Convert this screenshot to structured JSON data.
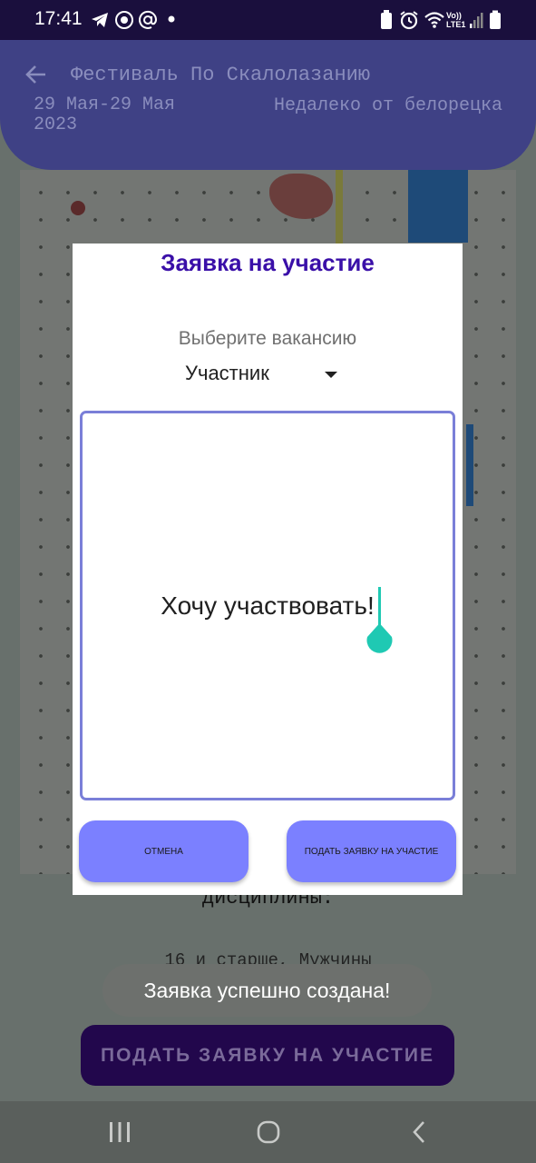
{
  "status_bar": {
    "time": "17:41",
    "left_icons": [
      "telegram-icon",
      "vpn-icon",
      "at-sign-icon",
      "notification-dot-icon"
    ],
    "right_icons": [
      "battery-saver-icon",
      "alarm-icon",
      "wifi-icon",
      "volte-lte-icon",
      "signal-icon",
      "battery-icon"
    ],
    "network_label": "Vo)) LTE1"
  },
  "header": {
    "title": "Фестиваль По Скалолазанию",
    "dates": "29 Мая-29 Мая 2023",
    "location": "Недалеко от белорецка"
  },
  "background_page": {
    "disciplines_text": "дисциплины:",
    "age_group_text": "16 и старше, Мужчины",
    "submit_button": "ПОДАТЬ ЗАЯВКУ НА УЧАСТИЕ"
  },
  "dialog": {
    "title": "Заявка на участие",
    "vacancy_label": "Выберите вакансию",
    "vacancy_selected": "Участник",
    "message_text": "Хочу участвовать!",
    "cancel_button": "отмена",
    "submit_button": "подать заявку на участие"
  },
  "toast": {
    "text": "Заявка успешно создана!"
  },
  "colors": {
    "accent": "#3a0fa8",
    "button": "#7b80ff",
    "header": "#3f4185",
    "cursor": "#1fc9b3"
  }
}
